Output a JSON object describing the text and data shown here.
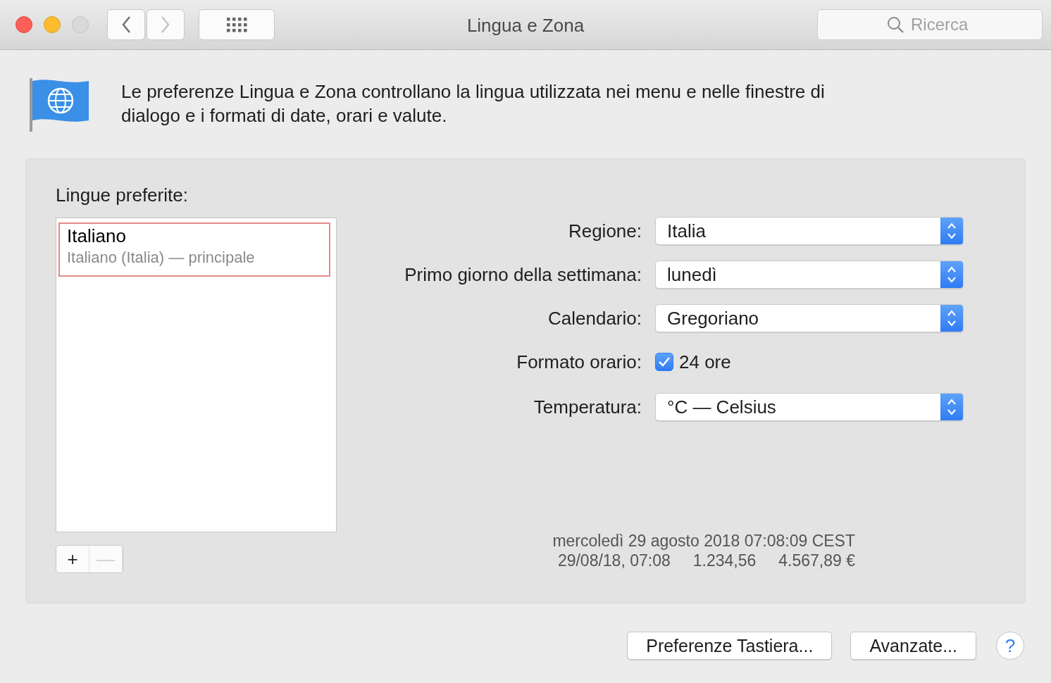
{
  "window": {
    "title": "Lingua e Zona",
    "nav": [
      {
        "kind": "back",
        "disabled": false
      },
      {
        "kind": "forward",
        "disabled": true
      }
    ],
    "search": {
      "placeholder": "Ricerca"
    }
  },
  "intro": "Le preferenze Lingua e Zona controllano la lingua utilizzata nei menu e nelle finestre di dialogo e i formati di date, orari e valute.",
  "languages": {
    "title": "Lingue preferite:",
    "items": [
      {
        "name": "Italiano",
        "detail": "Italiano (Italia) — principale",
        "selected": true
      }
    ],
    "buttons": [
      {
        "label": "+",
        "disabled": false
      },
      {
        "label": "—",
        "disabled": true
      }
    ]
  },
  "settings": [
    {
      "kind": "select",
      "label": "Regione:",
      "value": "Italia"
    },
    {
      "kind": "select",
      "label": "Primo giorno della settimana:",
      "value": "lunedì"
    },
    {
      "kind": "select",
      "label": "Calendario:",
      "value": "Gregoriano"
    },
    {
      "kind": "checkbox",
      "label": "Formato orario:",
      "value": "24 ore",
      "checked": true
    },
    {
      "kind": "select",
      "label": "Temperatura:",
      "value": "°C — Celsius"
    }
  ],
  "sample": {
    "long_date": "mercoledì 29 agosto 2018 07:08:09 CEST",
    "short_date": "29/08/18, 07:08",
    "number": "1.234,56",
    "currency": "4.567,89 €"
  },
  "buttons": [
    "Preferenze Tastiera...",
    "Avanzate..."
  ],
  "help": "?"
}
